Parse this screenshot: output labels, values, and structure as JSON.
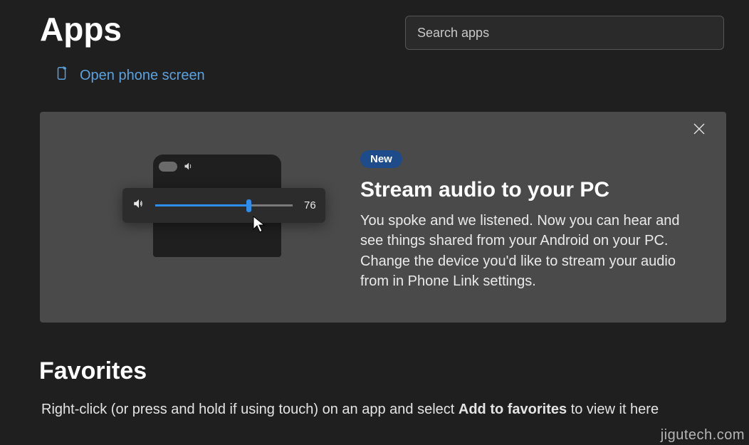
{
  "header": {
    "title": "Apps",
    "search_placeholder": "Search apps",
    "open_phone_link": "Open phone screen"
  },
  "card": {
    "badge": "New",
    "title": "Stream audio to your PC",
    "body": "You spoke and we listened. Now you can hear and see things shared from your Android on your PC. Change the device you'd like to stream your audio from in Phone Link settings.",
    "volume_value": "76",
    "volume_percent": 68
  },
  "favorites": {
    "heading": "Favorites",
    "hint_pre": "Right-click (or press and hold if using touch) on an app and select ",
    "hint_bold": "Add to favorites",
    "hint_post": " to view it here"
  },
  "watermark": "jigutech.com"
}
